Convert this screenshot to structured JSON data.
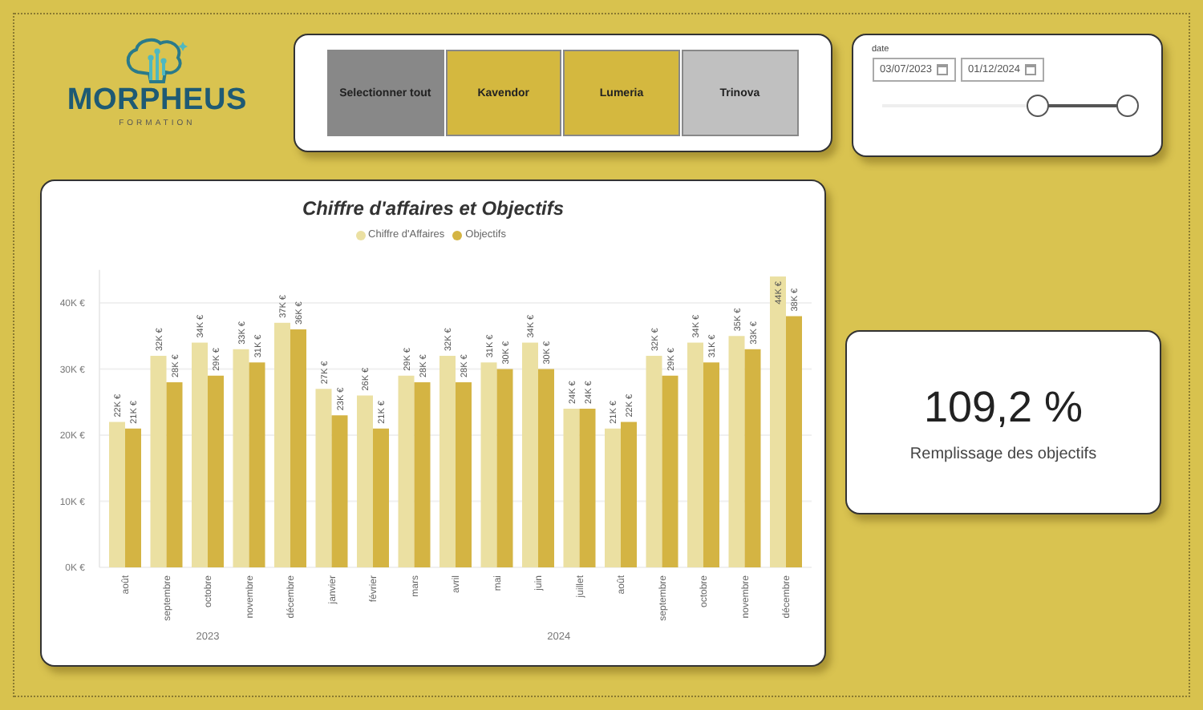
{
  "logo": {
    "name": "MORPHEUS",
    "subtitle": "FORMATION"
  },
  "slicer": {
    "items": [
      {
        "label": "Selectionner tout",
        "kind": "select-all",
        "selected": false
      },
      {
        "label": "Kavendor",
        "kind": "value",
        "selected": true
      },
      {
        "label": "Lumeria",
        "kind": "value",
        "selected": true
      },
      {
        "label": "Trinova",
        "kind": "value",
        "selected": false
      }
    ]
  },
  "date_filter": {
    "label": "date",
    "start": "03/07/2023",
    "end": "01/12/2024",
    "handles": [
      {
        "level": 0.64
      },
      {
        "level": 1
      }
    ]
  },
  "chart": {
    "year_labels": [
      {
        "label": "2023"
      },
      {
        "label": "2024"
      }
    ],
    "chart_data": {
      "type": "bar",
      "title": "Chiffre d'affaires et Objectifs",
      "categories": [
        "août",
        "septembre",
        "octobre",
        "novembre",
        "décembre",
        "janvier",
        "février",
        "mars",
        "avril",
        "mai",
        "juin",
        "juillet",
        "août",
        "septembre",
        "octobre",
        "novembre",
        "décembre"
      ],
      "series": [
        {
          "name": "Chiffre d'Affaires",
          "color": "#ebe0a2",
          "values": [
            22,
            32,
            34,
            33,
            37,
            27,
            26,
            29,
            32,
            31,
            34,
            24,
            21,
            32,
            34,
            35,
            44
          ],
          "value_labels": [
            "22K €",
            "32K €",
            "34K €",
            "33K €",
            "37K €",
            "27K €",
            "26K €",
            "29K €",
            "32K €",
            "31K €",
            "34K €",
            "24K €",
            "21K €",
            "32K €",
            "34K €",
            "35K €",
            "44K €"
          ]
        },
        {
          "name": "Objectifs",
          "color": "#d4b443",
          "values": [
            21,
            28,
            29,
            31,
            36,
            23,
            21,
            28,
            28,
            30,
            30,
            24,
            22,
            29,
            31,
            33,
            38
          ],
          "value_labels": [
            "21K €",
            "28K €",
            "29K €",
            "31K €",
            "36K €",
            "23K €",
            "21K €",
            "28K €",
            "28K €",
            "30K €",
            "30K €",
            "24K €",
            "22K €",
            "29K €",
            "31K €",
            "33K €",
            "38K €"
          ]
        }
      ],
      "ylim": [
        0,
        45
      ],
      "yticks": [
        {
          "value": 0,
          "label": "0K €"
        },
        {
          "value": 10,
          "label": "10K €"
        },
        {
          "value": 20,
          "label": "20K €"
        },
        {
          "value": 30,
          "label": "30K €"
        },
        {
          "value": 40,
          "label": "40K €"
        }
      ],
      "grid": true,
      "data_labels": true
    }
  },
  "kpi": {
    "value": "109,2 %",
    "label": "Remplissage des objectifs"
  }
}
